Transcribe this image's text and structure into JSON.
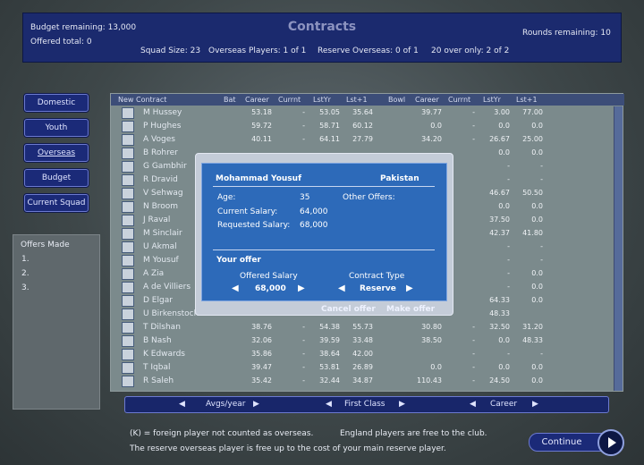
{
  "header": {
    "budget_remaining": "Budget remaining: 13,000",
    "offered_total": "Offered total: 0",
    "title": "Contracts",
    "rounds_remaining": "Rounds remaining: 10",
    "squad_size": "Squad Size: 23",
    "overseas_players": "Overseas Players: 1 of 1",
    "reserve_overseas": "Reserve Overseas: 0 of 1",
    "twenty_over_only": "20 over only: 2 of 2"
  },
  "nav": {
    "domestic": "Domestic",
    "youth": "Youth",
    "overseas": "Overseas",
    "budget": "Budget",
    "current_squad": "Current Squad"
  },
  "offers_made": {
    "title": "Offers Made",
    "items": [
      "1.",
      "2.",
      "3."
    ]
  },
  "table": {
    "headers": {
      "new_contract": "New Contract",
      "bat": "Bat",
      "career": "Career",
      "currnt": "Currnt",
      "lstyr": "LstYr",
      "lst1": "Lst+1",
      "bowl": "Bowl",
      "career2": "Career",
      "currnt2": "Currnt",
      "lstyr2": "LstYr",
      "lst1_2": "Lst+1"
    },
    "rows": [
      {
        "name": "M Hussey",
        "c1": "53.18",
        "c2": "-",
        "c3": "53.05",
        "c4": "35.64",
        "c5": "39.77",
        "c6": "-",
        "c7": "3.00",
        "c8": "77.00"
      },
      {
        "name": "P Hughes",
        "c1": "59.72",
        "c2": "-",
        "c3": "58.71",
        "c4": "60.12",
        "c5": "0.0",
        "c6": "-",
        "c7": "0.0",
        "c8": "0.0"
      },
      {
        "name": "A Voges",
        "c1": "40.11",
        "c2": "-",
        "c3": "64.11",
        "c4": "27.79",
        "c5": "34.20",
        "c6": "-",
        "c7": "26.67",
        "c8": "25.00"
      },
      {
        "name": "B Rohrer",
        "c1": "",
        "c2": "",
        "c3": "",
        "c4": "",
        "c5": "",
        "c6": "",
        "c7": "0.0",
        "c8": "0.0"
      },
      {
        "name": "G Gambhir",
        "c1": "",
        "c2": "",
        "c3": "",
        "c4": "",
        "c5": "",
        "c6": "",
        "c7": "-",
        "c8": "-"
      },
      {
        "name": "R Dravid",
        "c1": "",
        "c2": "",
        "c3": "",
        "c4": "",
        "c5": "",
        "c6": "",
        "c7": "-",
        "c8": "-"
      },
      {
        "name": "V Sehwag",
        "c1": "",
        "c2": "",
        "c3": "",
        "c4": "",
        "c5": "",
        "c6": "",
        "c7": "46.67",
        "c8": "50.50"
      },
      {
        "name": "N Broom",
        "c1": "",
        "c2": "",
        "c3": "",
        "c4": "",
        "c5": "",
        "c6": "",
        "c7": "0.0",
        "c8": "0.0"
      },
      {
        "name": "J Raval",
        "c1": "",
        "c2": "",
        "c3": "",
        "c4": "",
        "c5": "",
        "c6": "",
        "c7": "37.50",
        "c8": "0.0"
      },
      {
        "name": "M Sinclair",
        "c1": "",
        "c2": "",
        "c3": "",
        "c4": "",
        "c5": "",
        "c6": "",
        "c7": "42.37",
        "c8": "41.80"
      },
      {
        "name": "U Akmal",
        "c1": "",
        "c2": "",
        "c3": "",
        "c4": "",
        "c5": "",
        "c6": "",
        "c7": "-",
        "c8": "-"
      },
      {
        "name": "M Yousuf",
        "c1": "",
        "c2": "",
        "c3": "",
        "c4": "",
        "c5": "",
        "c6": "",
        "c7": "-",
        "c8": "-"
      },
      {
        "name": "A Zia",
        "c1": "",
        "c2": "",
        "c3": "",
        "c4": "",
        "c5": "",
        "c6": "",
        "c7": "-",
        "c8": "0.0"
      },
      {
        "name": "A de Villiers",
        "c1": "",
        "c2": "",
        "c3": "",
        "c4": "",
        "c5": "",
        "c6": "",
        "c7": "-",
        "c8": "0.0"
      },
      {
        "name": "D Elgar",
        "c1": "",
        "c2": "",
        "c3": "",
        "c4": "",
        "c5": "",
        "c6": "",
        "c7": "64.33",
        "c8": "0.0"
      },
      {
        "name": "U Birkenstock",
        "c1": "",
        "c2": "",
        "c3": "",
        "c4": "",
        "c5": "",
        "c6": "",
        "c7": "48.33",
        "c8": ""
      },
      {
        "name": "T Dilshan",
        "c1": "38.76",
        "c2": "-",
        "c3": "54.38",
        "c4": "55.73",
        "c5": "30.80",
        "c6": "-",
        "c7": "32.50",
        "c8": "31.20"
      },
      {
        "name": "B Nash",
        "c1": "32.06",
        "c2": "-",
        "c3": "39.59",
        "c4": "33.48",
        "c5": "38.50",
        "c6": "-",
        "c7": "0.0",
        "c8": "48.33"
      },
      {
        "name": "K Edwards",
        "c1": "35.86",
        "c2": "-",
        "c3": "38.64",
        "c4": "42.00",
        "c5": "",
        "c6": "-",
        "c7": "-",
        "c8": "-"
      },
      {
        "name": "T Iqbal",
        "c1": "39.47",
        "c2": "-",
        "c3": "53.81",
        "c4": "26.89",
        "c5": "0.0",
        "c6": "-",
        "c7": "0.0",
        "c8": "0.0"
      },
      {
        "name": "R Saleh",
        "c1": "35.42",
        "c2": "-",
        "c3": "32.44",
        "c4": "34.87",
        "c5": "110.43",
        "c6": "-",
        "c7": "24.50",
        "c8": "0.0"
      }
    ]
  },
  "bottom_nav": {
    "avgs": "Avgs/year",
    "first_class": "First Class",
    "career": "Career"
  },
  "footnotes": {
    "line1": "(K) = foreign player not counted as overseas.",
    "line1b": "England players are free to the club.",
    "line2": "The reserve overseas player is free up to the cost of your main reserve player."
  },
  "continue": "Continue",
  "modal": {
    "player_name": "Mohammad Yousuf",
    "country": "Pakistan",
    "age_label": "Age:",
    "age": "35",
    "other_offers_label": "Other Offers:",
    "current_salary_label": "Current Salary:",
    "current_salary": "64,000",
    "requested_salary_label": "Requested Salary:",
    "requested_salary": "68,000",
    "your_offer": "Your offer",
    "offered_salary_label": "Offered Salary",
    "offered_salary": "68,000",
    "contract_type_label": "Contract Type",
    "contract_type": "Reserve",
    "cancel_offer": "Cancel offer",
    "make_offer": "Make offer"
  }
}
